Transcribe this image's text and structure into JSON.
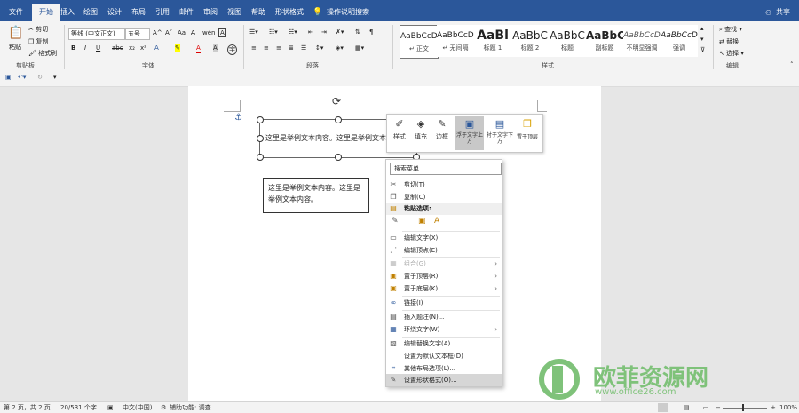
{
  "tabs": [
    "文件",
    "开始",
    "插入",
    "绘图",
    "设计",
    "布局",
    "引用",
    "邮件",
    "审阅",
    "视图",
    "帮助",
    "形状格式"
  ],
  "active_tab": "开始",
  "tell_me": "操作说明搜索",
  "share": "共享",
  "ribbon": {
    "clipboard": {
      "paste": "粘贴",
      "cut": "剪切",
      "copy": "复制",
      "format_painter": "格式刷",
      "label": "剪贴板"
    },
    "font": {
      "name": "等线 (中文正文)",
      "size": "五号",
      "label": "字体"
    },
    "paragraph": {
      "label": "段落"
    },
    "styles": {
      "items": [
        {
          "preview": "AaBbCcDc",
          "name": "正文"
        },
        {
          "preview": "AaBbCcDc",
          "name": "无间隔"
        },
        {
          "preview": "AaBl",
          "name": "标题 1"
        },
        {
          "preview": "AaBbC",
          "name": "标题 2"
        },
        {
          "preview": "AaBbC",
          "name": "标题"
        },
        {
          "preview": "AaBbC",
          "name": "副标题"
        },
        {
          "preview": "AaBbCcD",
          "name": "不明显强调"
        },
        {
          "preview": "AaBbCcD",
          "name": "强调"
        }
      ],
      "label": "样式"
    },
    "editing": {
      "find": "查找",
      "replace": "替换",
      "select": "选择",
      "label": "编辑"
    }
  },
  "document": {
    "textbox1": "这里是举例文本内容。这里是举例文本内容。",
    "textbox2": "这里是举例文本内容。这里是举例文本内容。"
  },
  "float_toolbar": [
    {
      "label": "样式",
      "icon": "style-icon"
    },
    {
      "label": "填充",
      "icon": "fill-icon"
    },
    {
      "label": "边框",
      "icon": "border-icon"
    },
    {
      "label": "浮于文字上方",
      "icon": "in-front-icon"
    },
    {
      "label": "衬于文字下方",
      "icon": "behind-icon"
    },
    {
      "label": "置于顶层",
      "icon": "bring-front-icon"
    }
  ],
  "context_menu": {
    "search": "搜索菜单",
    "items": [
      {
        "label": "剪切(T)",
        "icon": "✂"
      },
      {
        "label": "复制(C)",
        "icon": "❐"
      },
      {
        "label": "粘贴选项:",
        "icon": "📋",
        "section": true
      },
      {
        "label": "编辑文字(X)",
        "icon": "▭"
      },
      {
        "label": "编辑顶点(E)",
        "icon": "⋰"
      },
      {
        "label": "组合(G)",
        "icon": "▦",
        "arrow": "›",
        "disabled": true
      },
      {
        "label": "置于顶层(R)",
        "icon": "▣",
        "arrow": "›"
      },
      {
        "label": "置于底层(K)",
        "icon": "▣",
        "arrow": "›"
      },
      {
        "label": "链接(I)",
        "icon": "🔗"
      },
      {
        "label": "插入题注(N)...",
        "icon": "▤"
      },
      {
        "label": "环绕文字(W)",
        "icon": "▦",
        "arrow": "›"
      },
      {
        "label": "编辑替换文字(A)...",
        "icon": "▧"
      },
      {
        "label": "设置为默认文本框(D)",
        "icon": ""
      },
      {
        "label": "其他布局选项(L)...",
        "icon": "⌗"
      },
      {
        "label": "设置形状格式(O)...",
        "icon": "✎",
        "highlight": true
      }
    ]
  },
  "status": {
    "page": "第 2 页，共 2 页",
    "words": "20/531 个字",
    "lang": "中文(中国)",
    "access": "辅助功能: 调查",
    "zoom": "100%"
  },
  "watermark": {
    "title": "欧菲资源网",
    "url": "www.office26.com"
  },
  "colors": {
    "accent": "#2b579a",
    "watermark": "#7fc27a",
    "highlight": "#d6d6d6"
  }
}
